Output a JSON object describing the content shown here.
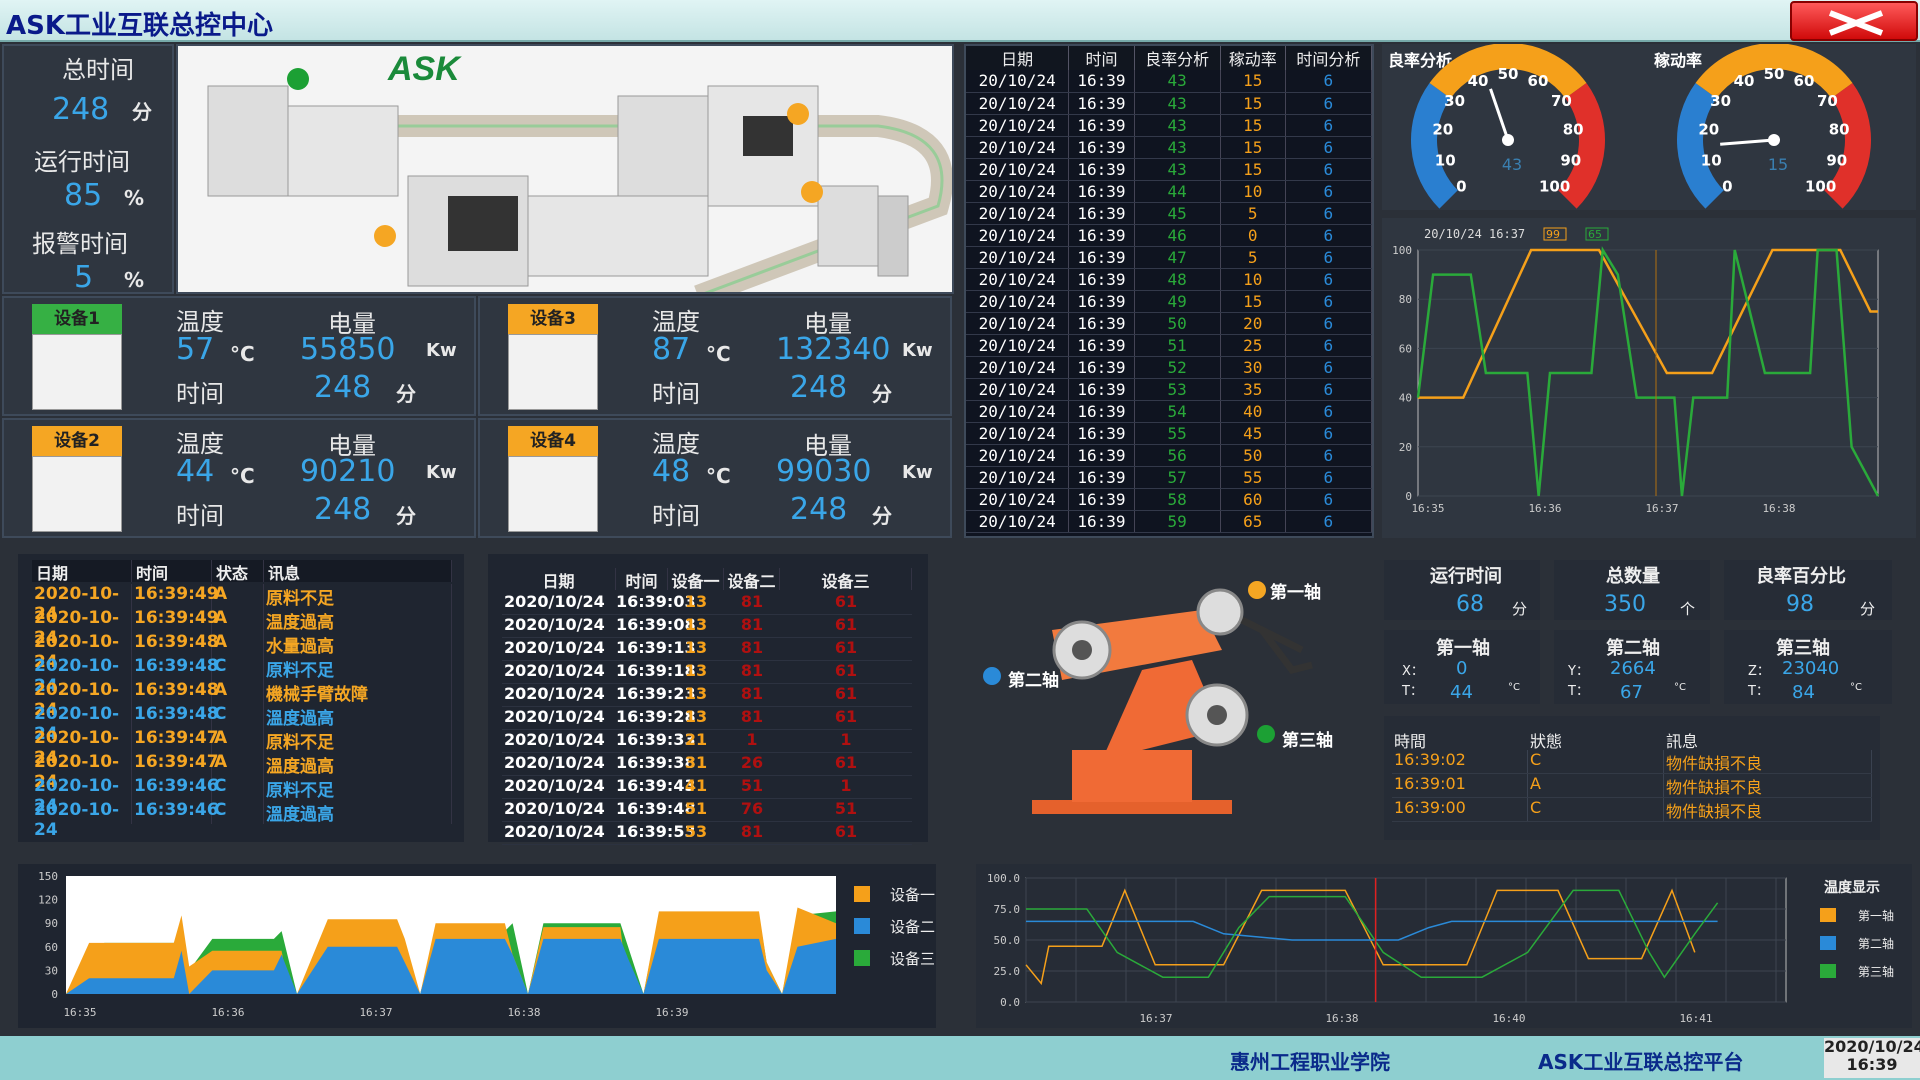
{
  "app": {
    "title": "ASK工业互联总控中心"
  },
  "summary": {
    "total_time_label": "总时间",
    "total_time_value": "248",
    "total_time_unit": "分",
    "run_time_label": "运行时间",
    "run_time_value": "85",
    "run_time_unit": "%",
    "alarm_time_label": "报警时间",
    "alarm_time_value": "5",
    "alarm_time_unit": "%"
  },
  "logo": "ASK",
  "devices": [
    {
      "tag": "设备1",
      "tag_color": "#36b044",
      "temp_label": "温度",
      "temp": "57",
      "temp_unit": "°C",
      "power_label": "电量",
      "power": "55850",
      "power_unit": "Kw",
      "time_label": "时间",
      "time": "248",
      "time_unit": "分"
    },
    {
      "tag": "设备3",
      "tag_color": "#f5a623",
      "temp_label": "温度",
      "temp": "87",
      "temp_unit": "°C",
      "power_label": "电量",
      "power": "132340",
      "power_unit": "Kw",
      "time_label": "时间",
      "time": "248",
      "time_unit": "分"
    },
    {
      "tag": "设备2",
      "tag_color": "#f5a623",
      "temp_label": "温度",
      "temp": "44",
      "temp_unit": "°C",
      "power_label": "电量",
      "power": "90210",
      "power_unit": "Kw",
      "time_label": "时间",
      "time": "248",
      "time_unit": "分"
    },
    {
      "tag": "设备4",
      "tag_color": "#f5a623",
      "temp_label": "温度",
      "temp": "48",
      "temp_unit": "°C",
      "power_label": "电量",
      "power": "99030",
      "power_unit": "Kw",
      "time_label": "时间",
      "time": "248",
      "time_unit": "分"
    }
  ],
  "history_table": {
    "headers": [
      "日期",
      "时间",
      "良率分析",
      "稼动率",
      "时间分析"
    ],
    "rows": [
      [
        "20/10/24",
        "16:39",
        "43",
        "15",
        "6"
      ],
      [
        "20/10/24",
        "16:39",
        "43",
        "15",
        "6"
      ],
      [
        "20/10/24",
        "16:39",
        "43",
        "15",
        "6"
      ],
      [
        "20/10/24",
        "16:39",
        "43",
        "15",
        "6"
      ],
      [
        "20/10/24",
        "16:39",
        "43",
        "15",
        "6"
      ],
      [
        "20/10/24",
        "16:39",
        "44",
        "10",
        "6"
      ],
      [
        "20/10/24",
        "16:39",
        "45",
        "5",
        "6"
      ],
      [
        "20/10/24",
        "16:39",
        "46",
        "0",
        "6"
      ],
      [
        "20/10/24",
        "16:39",
        "47",
        "5",
        "6"
      ],
      [
        "20/10/24",
        "16:39",
        "48",
        "10",
        "6"
      ],
      [
        "20/10/24",
        "16:39",
        "49",
        "15",
        "6"
      ],
      [
        "20/10/24",
        "16:39",
        "50",
        "20",
        "6"
      ],
      [
        "20/10/24",
        "16:39",
        "51",
        "25",
        "6"
      ],
      [
        "20/10/24",
        "16:39",
        "52",
        "30",
        "6"
      ],
      [
        "20/10/24",
        "16:39",
        "53",
        "35",
        "6"
      ],
      [
        "20/10/24",
        "16:39",
        "54",
        "40",
        "6"
      ],
      [
        "20/10/24",
        "16:39",
        "55",
        "45",
        "6"
      ],
      [
        "20/10/24",
        "16:39",
        "56",
        "50",
        "6"
      ],
      [
        "20/10/24",
        "16:39",
        "57",
        "55",
        "6"
      ],
      [
        "20/10/24",
        "16:39",
        "58",
        "60",
        "6"
      ],
      [
        "20/10/24",
        "16:39",
        "59",
        "65",
        "6"
      ]
    ]
  },
  "gauges": [
    {
      "title": "良率分析",
      "value": 43,
      "ticks": [
        "0",
        "10",
        "20",
        "30",
        "40",
        "50",
        "60",
        "70",
        "80",
        "90",
        "100"
      ]
    },
    {
      "title": "稼动率",
      "value": 15,
      "ticks": [
        "0",
        "10",
        "20",
        "30",
        "40",
        "50",
        "60",
        "70",
        "80",
        "90",
        "100"
      ]
    }
  ],
  "trend": {
    "timestamp": "20/10/24 16:37",
    "legend_a": "99",
    "legend_b": "65",
    "yticks": [
      "100",
      "80",
      "60",
      "40",
      "20",
      "0"
    ],
    "xticks": [
      "16:35",
      "16:36",
      "16:37",
      "16:38"
    ]
  },
  "events": {
    "headers": [
      "日期",
      "时间",
      "状态",
      "讯息"
    ],
    "rows": [
      {
        "date": "2020-10-24",
        "time": "16:39:49",
        "state": "A",
        "msg": "原料不足",
        "color": "#f5a623"
      },
      {
        "date": "2020-10-24",
        "time": "16:39:49",
        "state": "A",
        "msg": "温度過高",
        "color": "#f5a623"
      },
      {
        "date": "2020-10-24",
        "time": "16:39:48",
        "state": "A",
        "msg": "水量過高",
        "color": "#f5a623"
      },
      {
        "date": "2020-10-24",
        "time": "16:39:48",
        "state": "C",
        "msg": "原料不足",
        "color": "#3aa6e8"
      },
      {
        "date": "2020-10-24",
        "time": "16:39:48",
        "state": "A",
        "msg": "機械手臂故障",
        "color": "#f5a623"
      },
      {
        "date": "2020-10-24",
        "time": "16:39:48",
        "state": "C",
        "msg": "溫度過高",
        "color": "#3aa6e8"
      },
      {
        "date": "2020-10-24",
        "time": "16:39:47",
        "state": "A",
        "msg": "原料不足",
        "color": "#f5a623"
      },
      {
        "date": "2020-10-24",
        "time": "16:39:47",
        "state": "A",
        "msg": "溫度過高",
        "color": "#f5a623"
      },
      {
        "date": "2020-10-24",
        "time": "16:39:46",
        "state": "C",
        "msg": "原料不足",
        "color": "#3aa6e8"
      },
      {
        "date": "2020-10-24",
        "time": "16:39:46",
        "state": "C",
        "msg": "溫度過高",
        "color": "#3aa6e8"
      }
    ]
  },
  "device_log": {
    "headers": [
      "日期",
      "时间",
      "设备一",
      "设备二",
      "设备三"
    ],
    "rows": [
      [
        "2020/10/24",
        "16:39:03",
        "13",
        "81",
        "61"
      ],
      [
        "2020/10/24",
        "16:39:08",
        "13",
        "81",
        "61"
      ],
      [
        "2020/10/24",
        "16:39:13",
        "13",
        "81",
        "61"
      ],
      [
        "2020/10/24",
        "16:39:18",
        "13",
        "81",
        "61"
      ],
      [
        "2020/10/24",
        "16:39:23",
        "13",
        "81",
        "61"
      ],
      [
        "2020/10/24",
        "16:39:28",
        "13",
        "81",
        "61"
      ],
      [
        "2020/10/24",
        "16:39:33",
        "21",
        "1",
        "1"
      ],
      [
        "2020/10/24",
        "16:39:38",
        "31",
        "26",
        "61"
      ],
      [
        "2020/10/24",
        "16:39:43",
        "41",
        "51",
        "1"
      ],
      [
        "2020/10/24",
        "16:39:48",
        "51",
        "76",
        "51"
      ],
      [
        "2020/10/24",
        "16:39:53",
        "53",
        "81",
        "61"
      ]
    ]
  },
  "area_chart": {
    "yticks": [
      "150",
      "120",
      "90",
      "60",
      "30",
      "0"
    ],
    "xticks": [
      "16:35",
      "16:36",
      "16:37",
      "16:38",
      "16:39"
    ],
    "legend": [
      "设备一",
      "设备二",
      "设备三"
    ],
    "colors": [
      "#f5a01a",
      "#2a8ad8",
      "#2aaa3a"
    ]
  },
  "robot": {
    "axis1": "第一轴",
    "axis2": "第二轴",
    "axis3": "第三轴"
  },
  "stats": {
    "run_time_title": "运行时间",
    "run_time": "68",
    "run_time_unit": "分",
    "total_title": "总数量",
    "total": "350",
    "total_unit": "个",
    "yield_title": "良率百分比",
    "yield": "98",
    "yield_unit": "分",
    "axis1_title": "第一轴",
    "axis1_xlabel": "X：",
    "axis1_x": "0",
    "axis1_tlabel": "T：",
    "axis1_t": "44",
    "axis1_unit": "°C",
    "axis2_title": "第二轴",
    "axis2_ylabel": "Y：",
    "axis2_y": "2664",
    "axis2_tlabel": "T：",
    "axis2_t": "67",
    "axis2_unit": "°C",
    "axis3_title": "第三轴",
    "axis3_zlabel": "Z：",
    "axis3_z": "23040",
    "axis3_tlabel": "T：",
    "axis3_t": "84",
    "axis3_unit": "°C"
  },
  "alarm_log": {
    "headers": [
      "時間",
      "狀態",
      "訊息"
    ],
    "rows": [
      [
        "16:39:02",
        "C",
        "物件缺損不良"
      ],
      [
        "16:39:01",
        "A",
        "物件缺損不良"
      ],
      [
        "16:39:00",
        "C",
        "物件缺損不良"
      ]
    ]
  },
  "temp_chart": {
    "yticks": [
      "100.0",
      "75.0",
      "50.0",
      "25.0",
      "0.0"
    ],
    "xticks": [
      "16:37",
      "16:38",
      "16:40",
      "16:41"
    ],
    "legend_title": "温度显示",
    "legend": [
      "第一轴",
      "第二轴",
      "第三轴"
    ],
    "colors": [
      "#f5a01a",
      "#2a8ad8",
      "#2aaa3a"
    ]
  },
  "footer": {
    "school": "惠州工程职业学院",
    "platform": "ASK工业互联总控平台",
    "date": "2020/10/24",
    "time": "16:39"
  }
}
